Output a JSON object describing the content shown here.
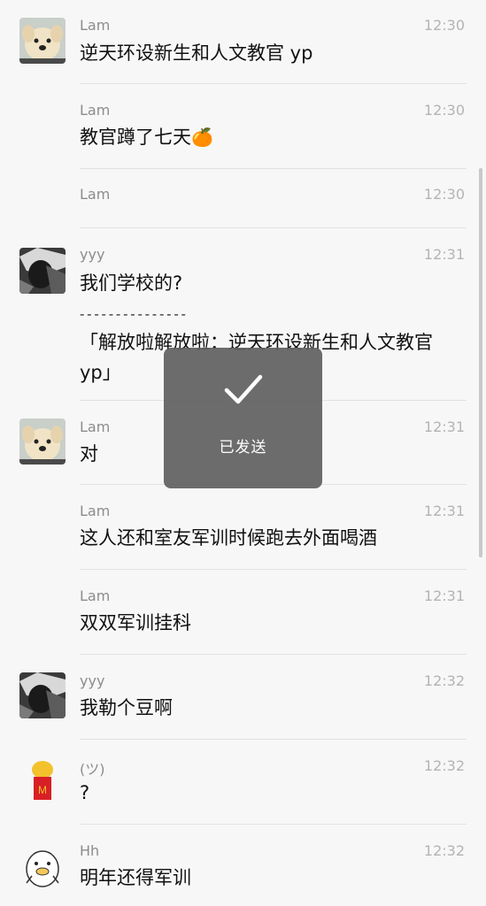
{
  "messages": [
    {
      "id": "m1",
      "sender": "Lam",
      "time": "12:30",
      "avatar": "dog-avatar",
      "text": "逆天环设新生和人文教官 yp"
    },
    {
      "id": "m2",
      "sender": "Lam",
      "time": "12:30",
      "avatar": "",
      "text": "教官蹲了七天",
      "emoji": "🍊"
    },
    {
      "id": "m3",
      "sender": "Lam",
      "time": "12:30",
      "avatar": "",
      "text": ""
    },
    {
      "id": "m4",
      "sender": "yyy",
      "time": "12:31",
      "avatar": "dark-avatar",
      "text": "我们学校的?",
      "quote_sep": "- - - - - - - - - - - - - - -",
      "quote": "「解放啦解放啦：逆天环设新生和人文教官 yp」"
    },
    {
      "id": "m5",
      "sender": "Lam",
      "time": "12:31",
      "avatar": "dog-avatar",
      "text": "对"
    },
    {
      "id": "m6",
      "sender": "Lam",
      "time": "12:31",
      "avatar": "",
      "text": "这人还和室友军训时候跑去外面喝酒"
    },
    {
      "id": "m7",
      "sender": "Lam",
      "time": "12:31",
      "avatar": "",
      "text": "双双军训挂科"
    },
    {
      "id": "m8",
      "sender": "yyy",
      "time": "12:32",
      "avatar": "dark-avatar",
      "text": "我勒个豆啊"
    },
    {
      "id": "m9",
      "sender": "(ツ)",
      "time": "12:32",
      "avatar": "fries-avatar",
      "text": "?"
    },
    {
      "id": "m10",
      "sender": "Hh",
      "time": "12:32",
      "avatar": "duck-avatar",
      "text": "明年还得军训"
    }
  ],
  "toast": {
    "label": "已发送",
    "icon": "check-icon"
  },
  "colors": {
    "background": "#f7f7f7",
    "toast": "#606060",
    "text": "#111111",
    "meta": "#8c8c8c"
  }
}
